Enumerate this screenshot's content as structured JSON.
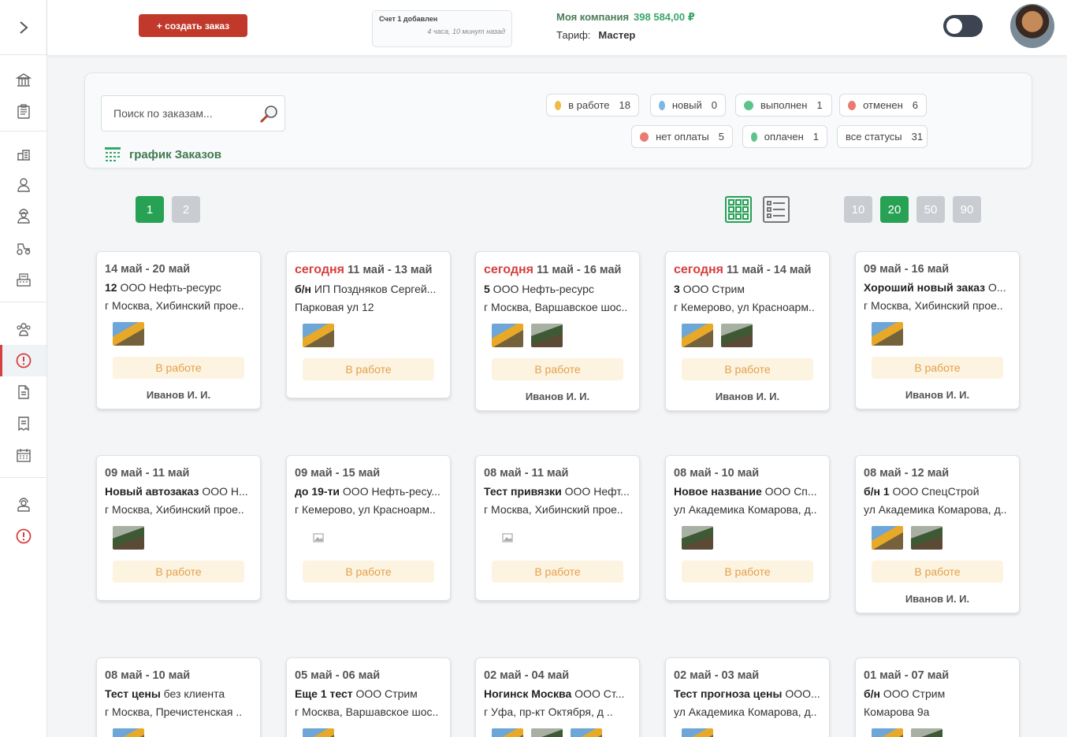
{
  "sidebar": {
    "top": [
      {
        "icon": "bank-icon"
      },
      {
        "icon": "document-list-icon"
      }
    ],
    "mid": [
      {
        "icon": "warehouse-icon"
      },
      {
        "icon": "driver-icon"
      },
      {
        "icon": "worker-icon"
      },
      {
        "icon": "tractor-icon"
      },
      {
        "icon": "register-icon"
      }
    ],
    "main": [
      {
        "icon": "team-icon"
      },
      {
        "icon": "alert-icon"
      },
      {
        "icon": "file-icon"
      },
      {
        "icon": "note-icon"
      },
      {
        "icon": "calendar-icon"
      }
    ],
    "bottom": [
      {
        "icon": "support-icon"
      },
      {
        "icon": "alert-red-icon"
      }
    ]
  },
  "header": {
    "create_label": "+ создать заказ",
    "notice_title": "Счет 1 добавлен",
    "notice_time": "4 часа, 10 минут назад",
    "company_name": "Моя компания",
    "company_balance": "398 584,00 ₽",
    "tariff_label": "Тариф:",
    "tariff_value": "Мастер"
  },
  "filter": {
    "search_placeholder": "Поиск по заказам...",
    "schedule_label": "график Заказов",
    "chips": [
      {
        "label": "в работе",
        "count": "18",
        "color": "#f0b94a"
      },
      {
        "label": "новый",
        "count": "0",
        "color": "#7cb8e6"
      },
      {
        "label": "выполнен",
        "count": "1",
        "color": "#5cc488"
      },
      {
        "label": "отменен",
        "count": "6",
        "color": "#ea7b73"
      },
      {
        "label": "нет оплаты",
        "count": "5",
        "color": "#ea7b73"
      },
      {
        "label": "оплачен",
        "count": "1",
        "color": "#5cc488"
      },
      {
        "label": "все статусы",
        "count": "31",
        "color": ""
      }
    ]
  },
  "pagination": {
    "pages": [
      "1",
      "2"
    ],
    "per_page": [
      "10",
      "20",
      "50",
      "90"
    ]
  },
  "cards": [
    {
      "today": "",
      "dates": "14 май - 20 май",
      "bold": "12",
      "rest": " ООО Нефть-ресурс",
      "addr": "г Москва, Хибинский прое..",
      "thumbs": [
        "crane"
      ],
      "status": "В работе",
      "manager": "Иванов И. И."
    },
    {
      "today": "сегодня",
      "dates": " 11 май - 13 май",
      "bold": "б/н",
      "rest": " ИП Поздняков Сергей...",
      "addr": "Парковая ул 12",
      "thumbs": [
        "crane"
      ],
      "status": "В работе",
      "manager": ""
    },
    {
      "today": "сегодня",
      "dates": " 11 май - 16 май",
      "bold": "5",
      "rest": " ООО Нефть-ресурс",
      "addr": "г Москва, Варшавское шос..",
      "thumbs": [
        "crane",
        "dig"
      ],
      "status": "В работе",
      "manager": "Иванов И. И."
    },
    {
      "today": "сегодня",
      "dates": " 11 май - 14 май",
      "bold": "3",
      "rest": " ООО Стрим",
      "addr": "г Кемерово, ул Красноарм..",
      "thumbs": [
        "crane",
        "dig"
      ],
      "status": "В работе",
      "manager": "Иванов И. И."
    },
    {
      "today": "",
      "dates": "09 май - 16 май",
      "bold": "Хороший новый заказ",
      "rest": " О...",
      "addr": "г Москва, Хибинский прое..",
      "thumbs": [
        "crane"
      ],
      "status": "В работе",
      "manager": "Иванов И. И."
    },
    {
      "today": "",
      "dates": "09 май - 11 май",
      "bold": "Новый автозаказ",
      "rest": " ООО Н...",
      "addr": "г Москва, Хибинский прое..",
      "thumbs": [
        "dig"
      ],
      "status": "В работе",
      "manager": ""
    },
    {
      "today": "",
      "dates": "09 май - 15 май",
      "bold": "до 19-ти",
      "rest": " ООО Нефть-ресу...",
      "addr": "г Кемерово, ул Красноарм..",
      "thumbs": [
        "ph"
      ],
      "status": "В работе",
      "manager": ""
    },
    {
      "today": "",
      "dates": "08 май - 11 май",
      "bold": "Тест привязки",
      "rest": " ООО Нефт...",
      "addr": "г Москва, Хибинский прое..",
      "thumbs": [
        "ph"
      ],
      "status": "В работе",
      "manager": ""
    },
    {
      "today": "",
      "dates": "08 май - 10 май",
      "bold": "Новое название",
      "rest": " ООО Сп...",
      "addr": "ул Академика Комарова, д..",
      "thumbs": [
        "dig"
      ],
      "status": "В работе",
      "manager": ""
    },
    {
      "today": "",
      "dates": "08 май - 12 май",
      "bold": "б/н 1",
      "rest": " ООО СпецСтрой",
      "addr": "ул Академика Комарова, д..",
      "thumbs": [
        "crane",
        "dig"
      ],
      "status": "В работе",
      "manager": "Иванов И. И."
    },
    {
      "today": "",
      "dates": "08 май - 10 май",
      "bold": "Тест цены",
      "rest": " без клиента",
      "addr": "г Москва, Пречистенская ..",
      "thumbs": [
        "crane"
      ],
      "status": "",
      "manager": ""
    },
    {
      "today": "",
      "dates": "05 май - 06 май",
      "bold": "Еще 1 тест",
      "rest": " ООО Стрим",
      "addr": "г Москва, Варшавское шос..",
      "thumbs": [
        "crane"
      ],
      "status": "",
      "manager": ""
    },
    {
      "today": "",
      "dates": "02 май - 04 май",
      "bold": "Ногинск Москва",
      "rest": " ООО Ст...",
      "addr": "г Уфа, пр-кт Октября, д ..",
      "thumbs": [
        "crane",
        "dig",
        "crane"
      ],
      "status": "",
      "manager": ""
    },
    {
      "today": "",
      "dates": "02 май - 03 май",
      "bold": "Тест прогноза цены",
      "rest": " ООО...",
      "addr": "ул Академика Комарова, д..",
      "thumbs": [
        "crane"
      ],
      "status": "",
      "manager": ""
    },
    {
      "today": "",
      "dates": "01 май - 07 май",
      "bold": "б/н",
      "rest": " ООО Стрим",
      "addr": "Комарова 9а",
      "thumbs": [
        "crane",
        "dig"
      ],
      "status": "",
      "manager": ""
    }
  ]
}
